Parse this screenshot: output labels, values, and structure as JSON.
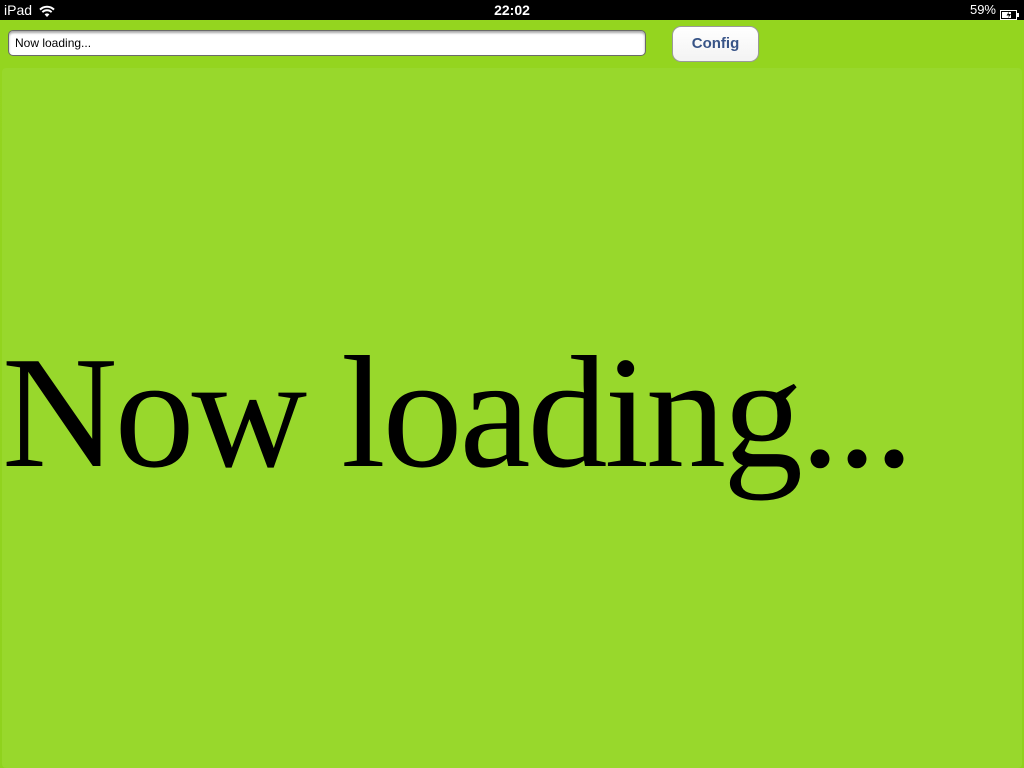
{
  "status_bar": {
    "device": "iPad",
    "wifi_icon": "wifi-icon",
    "time": "22:02",
    "battery_percent": "59%",
    "battery_icon": "battery-charging-icon"
  },
  "toolbar": {
    "url_value": "Now loading...",
    "config_label": "Config"
  },
  "content": {
    "loading_text": "Now loading..."
  },
  "colors": {
    "app_background": "#94d51f",
    "content_background": "#98d82c",
    "button_text": "#385487"
  }
}
